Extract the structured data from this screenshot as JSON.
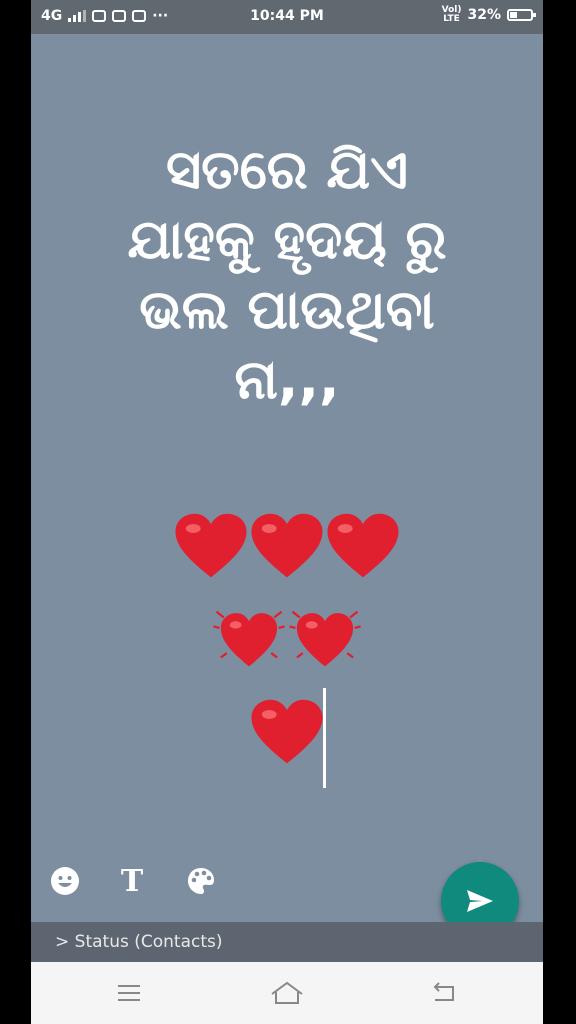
{
  "status_bar": {
    "network": "4G",
    "time": "10:44 PM",
    "volte_line1": "Vol)",
    "volte_line2": "LTE",
    "battery": "32%",
    "more": "···"
  },
  "status": {
    "lines": [
      "ସତରେ ଯିଏ",
      "ଯାହକୁ ହୃଦୟ ରୁ",
      "ଭଲ ପାଉଥିବା",
      "ନା,,,"
    ]
  },
  "toolbar": {
    "emoji_icon": "emoji-icon",
    "text_icon": "text-style-icon",
    "text_glyph": "T",
    "palette_icon": "palette-icon",
    "send_icon": "send-icon"
  },
  "send_to": {
    "label": "Status (Contacts)"
  },
  "colors": {
    "background": "#7d8ea1",
    "fab": "#0f8a7c",
    "heart": "#e0202e"
  }
}
